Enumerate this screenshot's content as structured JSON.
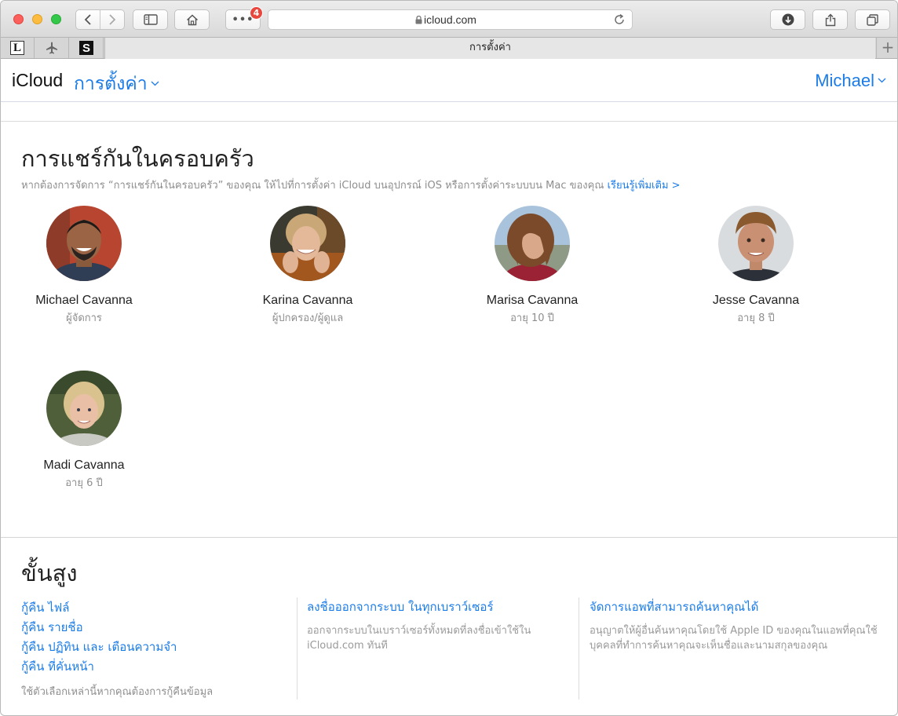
{
  "browser": {
    "url": "icloud.com",
    "badge_count": "4",
    "tab_title": "การตั้งค่า",
    "favorites": [
      "L",
      "S"
    ]
  },
  "header": {
    "brand": "iCloud",
    "section": "การตั้งค่า",
    "user": "Michael"
  },
  "family": {
    "title": "การแชร์กันในครอบครัว",
    "description": "หากต้องการจัดการ “การแชร์กันในครอบครัว” ของคุณ ให้ไปที่การตั้งค่า iCloud บนอุปกรณ์ iOS หรือการตั้งค่าระบบบน Mac ของคุณ",
    "learn_more": "เรียนรู้เพิ่มเติม >",
    "members": [
      {
        "name": "Michael Cavanna",
        "role": "ผู้จัดการ"
      },
      {
        "name": "Karina Cavanna",
        "role": "ผู้ปกครอง/ผู้ดูแล"
      },
      {
        "name": "Marisa Cavanna",
        "role": "อายุ 10 ปี"
      },
      {
        "name": "Jesse Cavanna",
        "role": "อายุ 8 ปี"
      },
      {
        "name": "Madi Cavanna",
        "role": "อายุ 6 ปี"
      }
    ]
  },
  "advanced": {
    "title": "ขั้นสูง",
    "restore_links": [
      "กู้คืน ไฟล์",
      "กู้คืน รายชื่อ",
      "กู้คืน ปฏิทิน และ เตือนความจำ",
      "กู้คืน ที่คั่นหน้า"
    ],
    "restore_note": "ใช้ตัวเลือกเหล่านี้หากคุณต้องการกู้คืนข้อมูล",
    "signout": {
      "title": "ลงชื่อออกจากระบบ ในทุกเบราว์เซอร์",
      "desc": "ออกจากระบบในเบราว์เซอร์ทั้งหมดที่ลงชื่อเข้าใช้ใน iCloud.com ทันที"
    },
    "apps": {
      "title": "จัดการแอพที่สามารถค้นหาคุณได้",
      "desc": "อนุญาตให้ผู้อื่นค้นหาคุณโดยใช้ Apple ID ของคุณในแอพที่คุณใช้ บุคคลที่ทำการค้นหาคุณจะเห็นชื่อและนามสกุลของคุณ"
    }
  },
  "colors": {
    "accent": "#1b7ce8",
    "muted": "#8e8e8e",
    "badge": "#e8473e"
  }
}
